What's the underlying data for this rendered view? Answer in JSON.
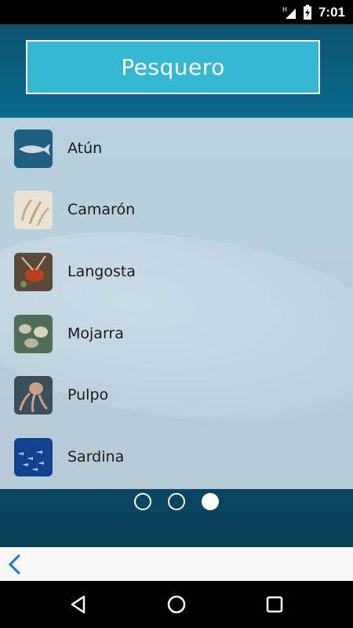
{
  "status_bar": {
    "time": "7:01"
  },
  "app": {
    "title": "Pesquero"
  },
  "items": [
    {
      "label": "Atún"
    },
    {
      "label": "Camarón"
    },
    {
      "label": "Langosta"
    },
    {
      "label": "Mojarra"
    },
    {
      "label": "Pulpo"
    },
    {
      "label": "Sardina"
    }
  ],
  "pager": {
    "total": 3,
    "active": 3
  },
  "icons": {
    "back": "chevron-left-icon",
    "nav_back": "triangle-back-icon",
    "nav_home": "circle-home-icon",
    "nav_recents": "square-recents-icon"
  },
  "colors": {
    "title_bg": "#35b9d2",
    "accent": "#1a73e8"
  }
}
